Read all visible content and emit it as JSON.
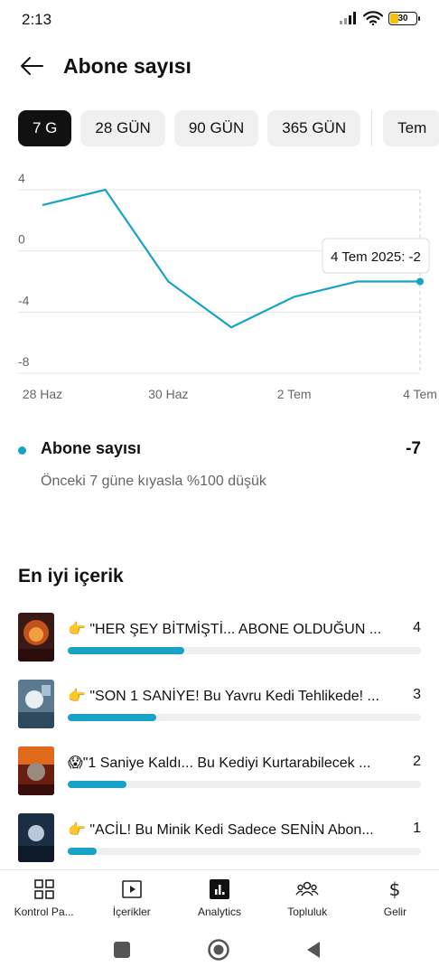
{
  "status_bar": {
    "time": "2:13",
    "battery": "30"
  },
  "header": {
    "title": "Abone sayısı"
  },
  "tabs": [
    {
      "label": "7 G",
      "active": true
    },
    {
      "label": "28 GÜN",
      "active": false
    },
    {
      "label": "90 GÜN",
      "active": false
    },
    {
      "label": "365 GÜN",
      "active": false
    },
    {
      "label": "Tem",
      "active": false
    }
  ],
  "chart_data": {
    "type": "line",
    "x": [
      "28 Haz",
      "29 Haz",
      "30 Haz",
      "1 Tem",
      "2 Tem",
      "3 Tem",
      "4 Tem"
    ],
    "x_tick_labels": [
      "28 Haz",
      "30 Haz",
      "2 Tem",
      "4 Tem"
    ],
    "y_tick_labels": [
      "4",
      "0",
      "-4",
      "-8"
    ],
    "series": [
      {
        "values": [
          3,
          4,
          -2,
          -5,
          -3,
          -2,
          -2
        ]
      }
    ],
    "ylim": [
      -8,
      4
    ],
    "grid": true,
    "tooltip": "4 Tem 2025: -2",
    "color": "#16a3c6"
  },
  "summary": {
    "label": "Abone sayısı",
    "value": "-7",
    "comparison": "Önceki 7 güne kıyasla %100 düşük"
  },
  "top_content": {
    "title": "En iyi içerik",
    "items": [
      {
        "emoji": "👉",
        "title": "\"HER ŞEY BİTMİŞTİ... ABONE OLDUĞUN ...",
        "count": "4",
        "fraction": 0.33
      },
      {
        "emoji": "👉",
        "title": "\"SON 1 SANİYE! Bu Yavru Kedi Tehlikede! ...",
        "count": "3",
        "fraction": 0.25
      },
      {
        "emoji": "😱",
        "title": "\"1 Saniye Kaldı... Bu Kediyi Kurtarabilecek ...",
        "count": "2",
        "fraction": 0.165
      },
      {
        "emoji": "👉",
        "title": "\"ACİL! Bu Minik Kedi Sadece SENİN Abon...",
        "count": "1",
        "fraction": 0.083
      }
    ]
  },
  "bottom_nav": [
    {
      "label": "Kontrol Pa...",
      "icon": "dashboard-icon"
    },
    {
      "label": "İçerikler",
      "icon": "content-icon"
    },
    {
      "label": "Analytics",
      "icon": "analytics-icon"
    },
    {
      "label": "Topluluk",
      "icon": "community-icon"
    },
    {
      "label": "Gelir",
      "icon": "earn-icon"
    }
  ]
}
